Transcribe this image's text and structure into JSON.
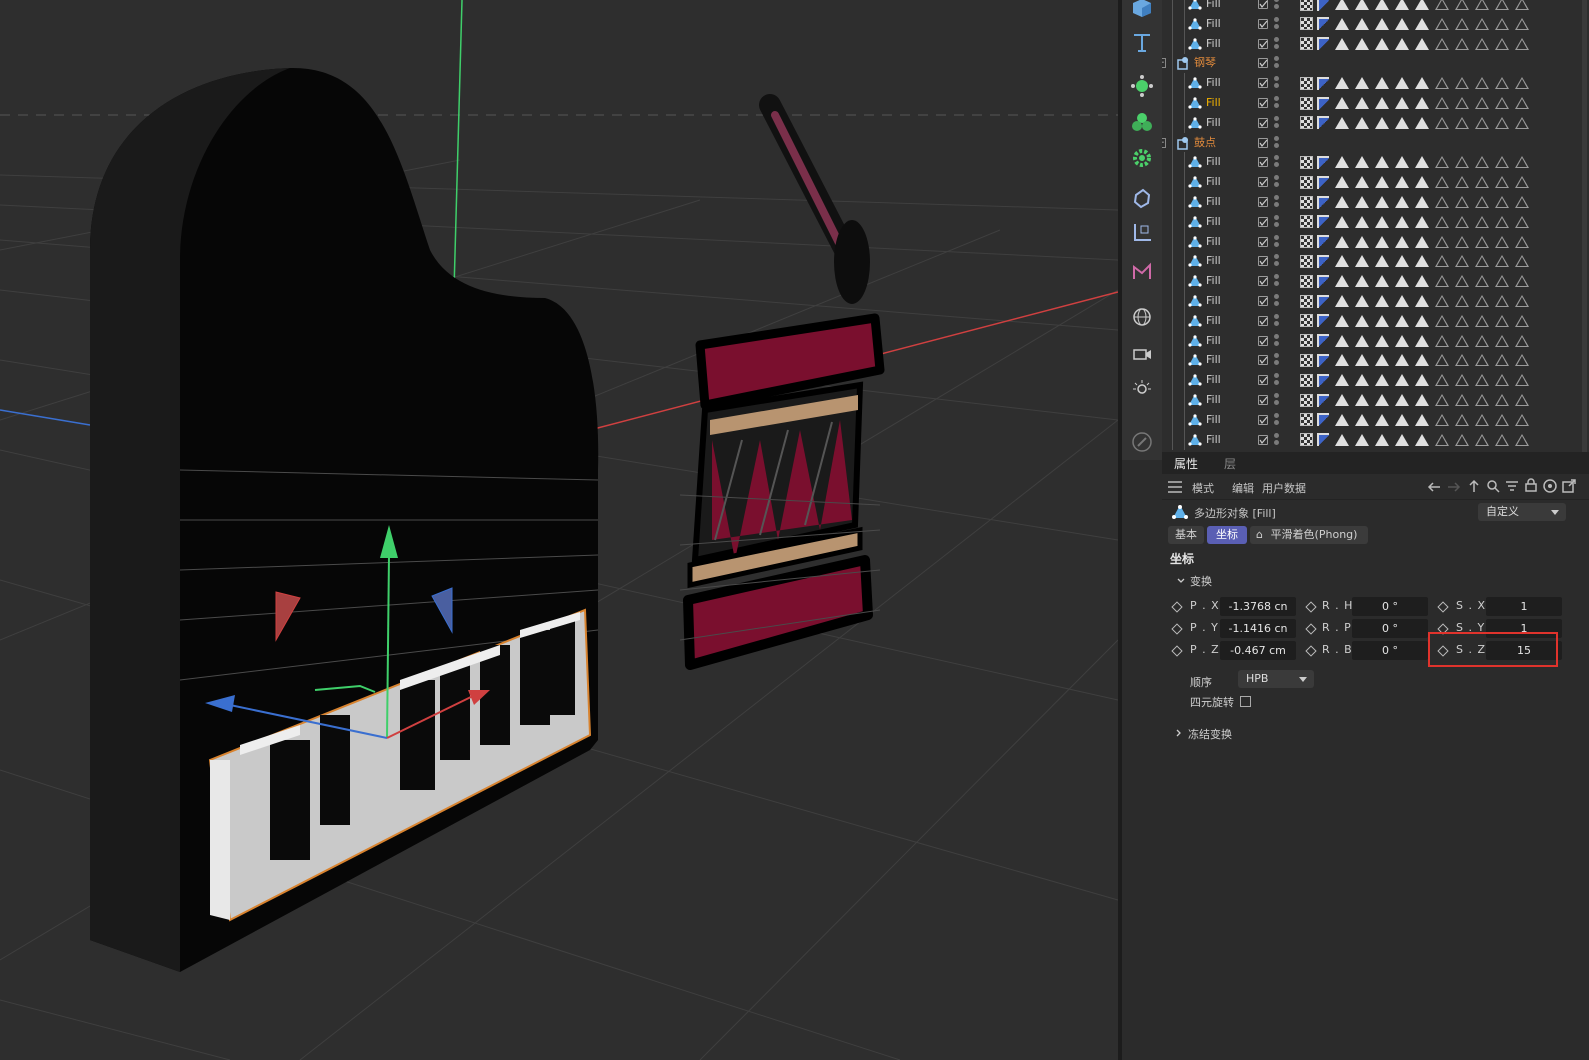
{
  "object_manager": {
    "rows": [
      {
        "name": "Fill",
        "type": "fill",
        "selected": false,
        "indent": 2
      },
      {
        "name": "Fill",
        "type": "fill",
        "selected": false,
        "indent": 2
      },
      {
        "name": "Fill",
        "type": "fill",
        "selected": false,
        "indent": 2
      },
      {
        "name": "钢琴",
        "type": "group",
        "selected": false,
        "indent": 1
      },
      {
        "name": "Fill",
        "type": "fill",
        "selected": false,
        "indent": 2
      },
      {
        "name": "Fill",
        "type": "fill",
        "selected": true,
        "indent": 2
      },
      {
        "name": "Fill",
        "type": "fill",
        "selected": false,
        "indent": 2
      },
      {
        "name": "鼓点",
        "type": "group2",
        "selected": false,
        "indent": 1
      },
      {
        "name": "Fill",
        "type": "fill",
        "selected": false,
        "indent": 2
      },
      {
        "name": "Fill",
        "type": "fill",
        "selected": false,
        "indent": 2
      },
      {
        "name": "Fill",
        "type": "fill",
        "selected": false,
        "indent": 2
      },
      {
        "name": "Fill",
        "type": "fill",
        "selected": false,
        "indent": 2
      },
      {
        "name": "Fill",
        "type": "fill",
        "selected": false,
        "indent": 2
      },
      {
        "name": "Fill",
        "type": "fill",
        "selected": false,
        "indent": 2
      },
      {
        "name": "Fill",
        "type": "fill",
        "selected": false,
        "indent": 2
      },
      {
        "name": "Fill",
        "type": "fill",
        "selected": false,
        "indent": 2
      },
      {
        "name": "Fill",
        "type": "fill",
        "selected": false,
        "indent": 2
      },
      {
        "name": "Fill",
        "type": "fill",
        "selected": false,
        "indent": 2
      },
      {
        "name": "Fill",
        "type": "fill",
        "selected": false,
        "indent": 2
      },
      {
        "name": "Fill",
        "type": "fill",
        "selected": false,
        "indent": 2
      },
      {
        "name": "Fill",
        "type": "fill",
        "selected": false,
        "indent": 2
      },
      {
        "name": "Fill",
        "type": "fill",
        "selected": false,
        "indent": 2
      },
      {
        "name": "Fill",
        "type": "fill",
        "selected": false,
        "indent": 2
      }
    ],
    "group_expander": "−"
  },
  "toolbar": {
    "icons": [
      "cube-icon",
      "text-icon",
      "mograph-cloner-icon",
      "voronoi-icon",
      "gear-effector-icon",
      "deformer-icon",
      "coordinate-icon",
      "spline-pen-icon",
      "globe-st-icon",
      "camera-st-icon",
      "light-st-icon",
      "edit-icon"
    ]
  },
  "attributes": {
    "tabs": {
      "properties": "属性",
      "layers": "层"
    },
    "menu": {
      "mode": "模式",
      "edit": "编辑",
      "user_data": "用户数据"
    },
    "object_title": "多边形对象 [Fill]",
    "preset": "自定义",
    "mode_buttons": {
      "basic": "基本",
      "coord": "坐标",
      "phong": "平滑着色(Phong)"
    },
    "section_title": "坐标",
    "transform_label": "变换",
    "fields": {
      "px_label": "P . X",
      "px": "-1.3768 cn",
      "py_label": "P . Y",
      "py": "-1.1416 cn",
      "pz_label": "P . Z",
      "pz": "-0.467 cm",
      "rh_label": "R . H",
      "rh": "0 °",
      "rp_label": "R . P",
      "rp": "0 °",
      "rb_label": "R . B",
      "rb": "0 °",
      "sx_label": "S . X",
      "sx": "1",
      "sy_label": "S . Y",
      "sy": "1",
      "sz_label": "S . Z",
      "sz": "15"
    },
    "order_label": "顺序",
    "order_value": "HPB",
    "quaternion_label": "四元旋转",
    "freeze_label": "冻结变换"
  },
  "colors": {
    "accent_tab": "#5a5fb4",
    "highlight_box": "#e0332c",
    "selected_name": "#f4b400",
    "axis_x": "#d04040",
    "axis_y": "#3fcf6a",
    "axis_z": "#3a6fd0",
    "drum_red": "#7a0f2e",
    "drum_tan": "#b89470"
  }
}
